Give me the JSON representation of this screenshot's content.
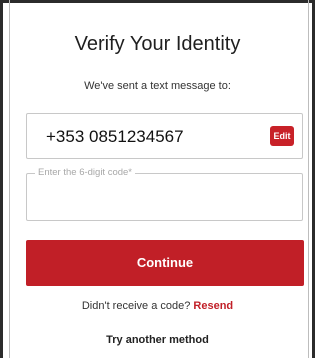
{
  "verify": {
    "title": "Verify Your Identity",
    "subtitle": "We've sent a text message to:",
    "phone_number": "+353 0851234567",
    "edit_label": "Edit",
    "code_label": "Enter the 6-digit code*",
    "code_value": "",
    "continue_label": "Continue",
    "resend_prompt": "Didn't receive a code?",
    "resend_label": "Resend",
    "try_another_label": "Try another method"
  },
  "colors": {
    "accent": "#c11f27",
    "border": "#c8c8c8",
    "text": "#1f1f1f"
  }
}
